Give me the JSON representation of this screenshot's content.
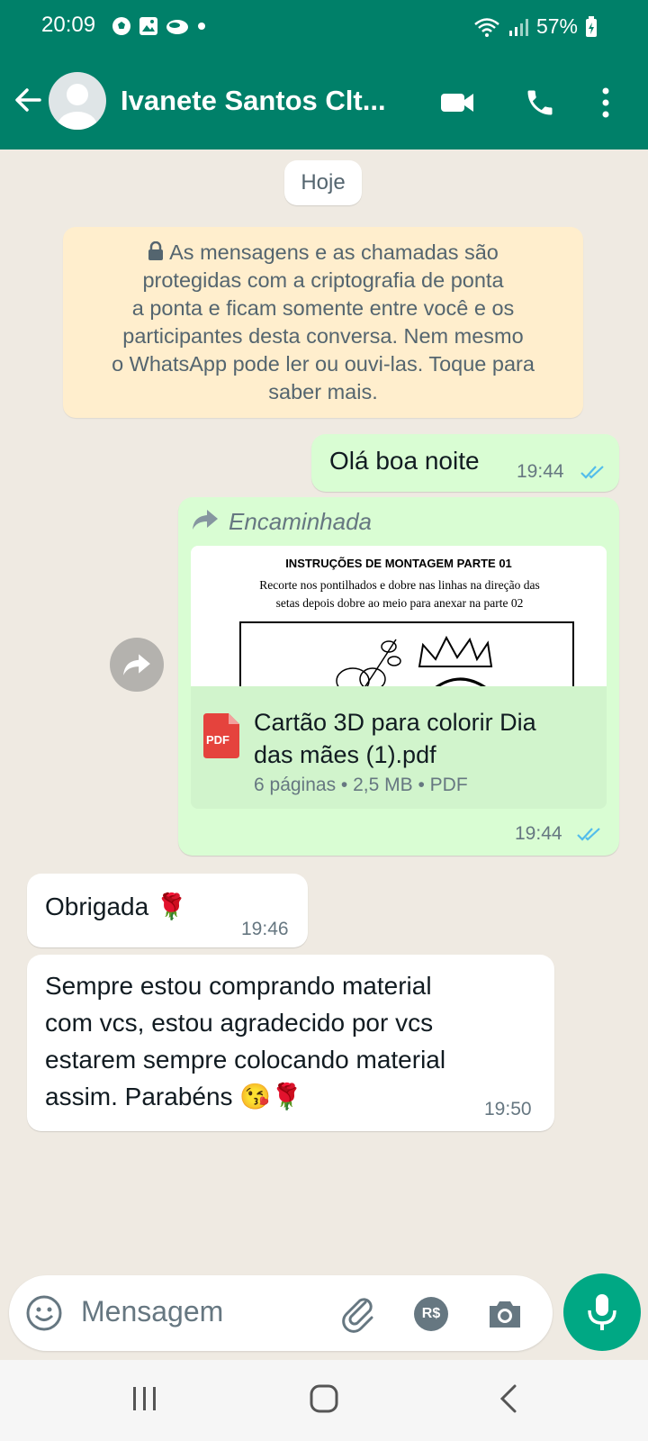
{
  "status_bar": {
    "time": "20:09",
    "battery": "57%",
    "notification_icons": [
      "soccer-ball-icon",
      "image-icon",
      "bowl-icon",
      "dot-icon"
    ],
    "system_icons": [
      "wifi-icon",
      "signal-icon",
      "battery-icon"
    ]
  },
  "header": {
    "contact_name": "Ivanete Santos Clt...",
    "icons": [
      "back-arrow-icon",
      "avatar-icon",
      "video-call-icon",
      "phone-icon",
      "more-vert-icon"
    ]
  },
  "chat": {
    "date_label": "Hoje",
    "encryption_notice": {
      "icon": "lock-icon",
      "lines": [
        "As mensagens e as chamadas são",
        "protegidas com a criptografia de ponta",
        "a ponta e ficam somente entre você e os",
        "participantes desta conversa. Nem mesmo",
        "o WhatsApp pode ler ou ouvi-las. Toque para",
        "saber mais."
      ]
    },
    "messages": [
      {
        "direction": "outgoing",
        "text": "Olá boa noite",
        "time": "19:44",
        "status": "read"
      },
      {
        "direction": "outgoing",
        "type": "document",
        "forwarded_label": "Encaminhada",
        "preview_title": "INSTRUÇÕES DE MONTAGEM PARTE 01",
        "preview_lines": [
          "Recorte nos pontilhados e dobre nas linhas na direção das",
          "setas  depois dobre ao meio para  anexar na parte 02"
        ],
        "file_icon_label": "PDF",
        "file_name_lines": [
          "Cartão 3D para colorir Dia",
          "das mães  (1).pdf"
        ],
        "file_meta": "6 páginas • 2,5 MB • PDF",
        "time": "19:44",
        "status": "read"
      },
      {
        "direction": "incoming",
        "text": "Obrigada 🌹",
        "time": "19:46"
      },
      {
        "direction": "incoming",
        "text_lines": [
          "Sempre estou comprando material",
          "com vcs, estou agradecido por vcs",
          "estarem sempre colocando material",
          "assim. Parabéns 😘🌹"
        ],
        "time": "19:50"
      }
    ]
  },
  "input_bar": {
    "placeholder": "Mensagem",
    "icons": [
      "emoji-icon",
      "attach-icon",
      "payment-icon",
      "camera-icon",
      "mic-icon"
    ],
    "payment_label": "R$"
  },
  "colors": {
    "header": "#008069",
    "outgoing_bubble": "#d9fdd3",
    "incoming_bubble": "#ffffff",
    "notice_bg": "#ffeecd",
    "accent": "#00a884",
    "read_ticks": "#53bdeb"
  }
}
